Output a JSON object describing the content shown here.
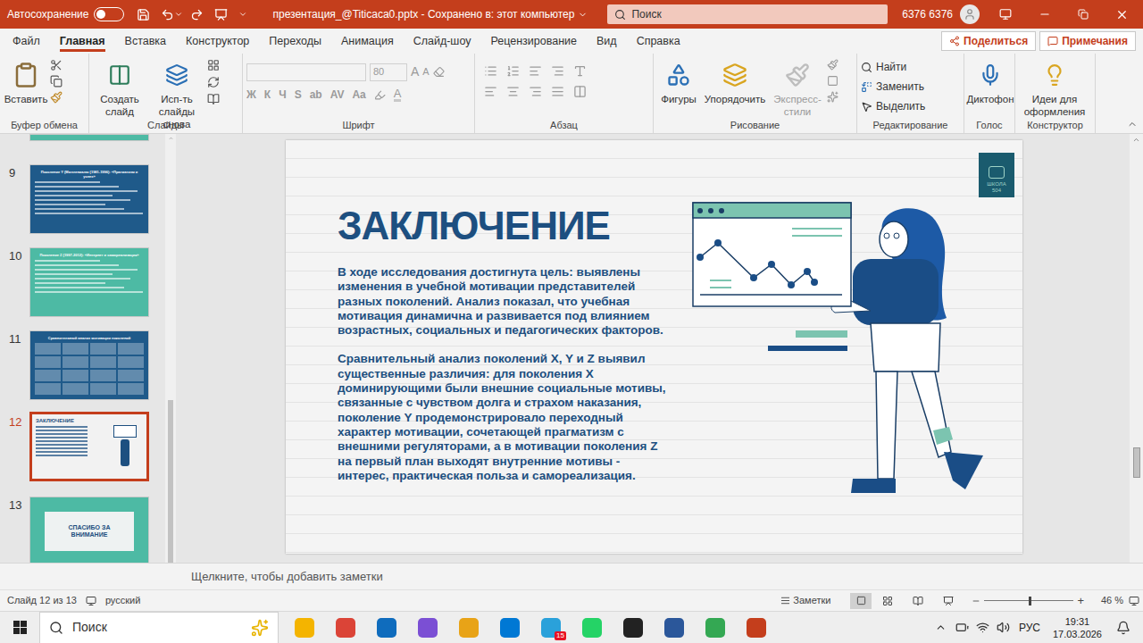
{
  "titlebar": {
    "autosave_label": "Автосохранение",
    "autosave_on": false,
    "document_title": "презентация_@Titicaca0.pptx - Сохранено в: этот компьютер",
    "search_placeholder": "Поиск",
    "user_name": "6376 6376"
  },
  "menu_tabs": [
    {
      "label": "Файл",
      "selected": false
    },
    {
      "label": "Главная",
      "selected": true
    },
    {
      "label": "Вставка",
      "selected": false
    },
    {
      "label": "Конструктор",
      "selected": false
    },
    {
      "label": "Переходы",
      "selected": false
    },
    {
      "label": "Анимация",
      "selected": false
    },
    {
      "label": "Слайд-шоу",
      "selected": false
    },
    {
      "label": "Рецензирование",
      "selected": false
    },
    {
      "label": "Вид",
      "selected": false
    },
    {
      "label": "Справка",
      "selected": false
    }
  ],
  "share_button": "Поделиться",
  "comments_button": "Примечания",
  "ribbon": {
    "clipboard": {
      "label": "Буфер обмена",
      "paste": "Вставить"
    },
    "slides": {
      "label": "Слайды",
      "new_slide": "Создать слайд",
      "reuse": "Исп-ть слайды снова"
    },
    "font": {
      "label": "Шрифт",
      "size": "80",
      "disabled": true,
      "grow": "A",
      "shrink": "A",
      "styles": [
        "Ж",
        "К",
        "Ч",
        "S",
        "ab",
        "AV",
        "Aa"
      ],
      "color": "A"
    },
    "paragraph": {
      "label": "Абзац"
    },
    "drawing": {
      "label": "Рисование",
      "shapes": "Фигуры",
      "arrange": "Упорядочить",
      "quick_styles": "Экспресс-стили",
      "quick_styles_disabled": true
    },
    "editing": {
      "label": "Редактирование",
      "find": "Найти",
      "replace": "Заменить",
      "select": "Выделить"
    },
    "voice": {
      "label": "Голос",
      "dictate": "Диктофон"
    },
    "designer": {
      "label": "Конструктор",
      "ideas": "Идеи для оформления"
    }
  },
  "thumbnails": [
    {
      "number": "9",
      "title": "Поколение Y (Миллениалы (1981-1996): «Прагматизм и успех»",
      "kind": "text",
      "color": "#1f5a8a",
      "selected": false
    },
    {
      "number": "10",
      "title": "Поколение Z (1997-2012): «Интернет и самореализация»",
      "kind": "text",
      "color": "#4dbaa4",
      "selected": false
    },
    {
      "number": "11",
      "title": "Сравнительный анализ мотивации поколений",
      "kind": "table",
      "color": "#1f5a8a",
      "selected": false
    },
    {
      "number": "12",
      "title": "ЗАКЛЮЧЕНИЕ",
      "kind": "conclusion",
      "color": "#f2f2f2",
      "selected": true
    },
    {
      "number": "13",
      "title": "СПАСИБО ЗА ВНИМАНИЕ",
      "kind": "thanks",
      "color": "#4dbaa4",
      "selected": false
    }
  ],
  "slide": {
    "title": "ЗАКЛЮЧЕНИЕ",
    "paragraphs": [
      "В ходе исследования достигнута цель: выявлены изменения в учебной мотивации представителей разных поколений. Анализ показал, что учебная мотивация динамична и развивается под влиянием возрастных, социальных и педагогических факторов.",
      "Сравнительный анализ поколений X, Y и Z выявил существенные различия: для поколения X доминирующими были внешние социальные мотивы, связанные с чувством долга и страхом наказания, поколение Y продемонстрировало переходный характер мотивации, сочетающей прагматизм с внешними регуляторами, а в мотивации поколения Z на первый план выходят внутренние мотивы - интерес, практическая польза и самореализация."
    ],
    "logo": [
      "ШКОЛА",
      "504"
    ],
    "chart": {
      "values": [
        38,
        54,
        15,
        30,
        7,
        22,
        10
      ]
    }
  },
  "notes_placeholder": "Щелкните, чтобы добавить заметки",
  "status_bar": {
    "slide_info": "Слайд 12 из 13",
    "language": "русский",
    "notes": "Заметки",
    "zoom": "46 %",
    "zoom_level": 0.5
  },
  "taskbar": {
    "search": "Поиск",
    "language": "РУС",
    "time": "19:31",
    "date": "17.03.2026",
    "telegram_badge": "15"
  }
}
